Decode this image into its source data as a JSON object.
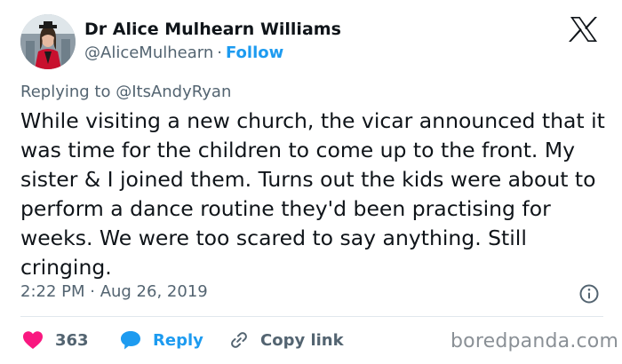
{
  "author": {
    "name": "Dr Alice Mulhearn Williams",
    "handle": "@AliceMulhearn",
    "separator": "·",
    "follow_label": "Follow",
    "avatar_icon": "profile-photo-avatar"
  },
  "platform_logo": "x-logo-icon",
  "replying": "Replying to @ItsAndyRyan",
  "tweet_text": "While visiting a new church, the vicar announced that it was time for the children to come up to the front. My sister & I joined them. Turns out the kids were about to perform a dance routine they'd been practising for weeks. We were too scared to say anything. Still cringing.",
  "timestamp": "2:22 PM · Aug 26, 2019",
  "actions": {
    "like_count": "363",
    "reply_label": "Reply",
    "copy_label": "Copy link"
  },
  "watermark": "boredpanda.com",
  "colors": {
    "accent": "#1d9bf0",
    "heart": "#f91880",
    "muted_text": "#536471",
    "text": "#0f1419"
  }
}
